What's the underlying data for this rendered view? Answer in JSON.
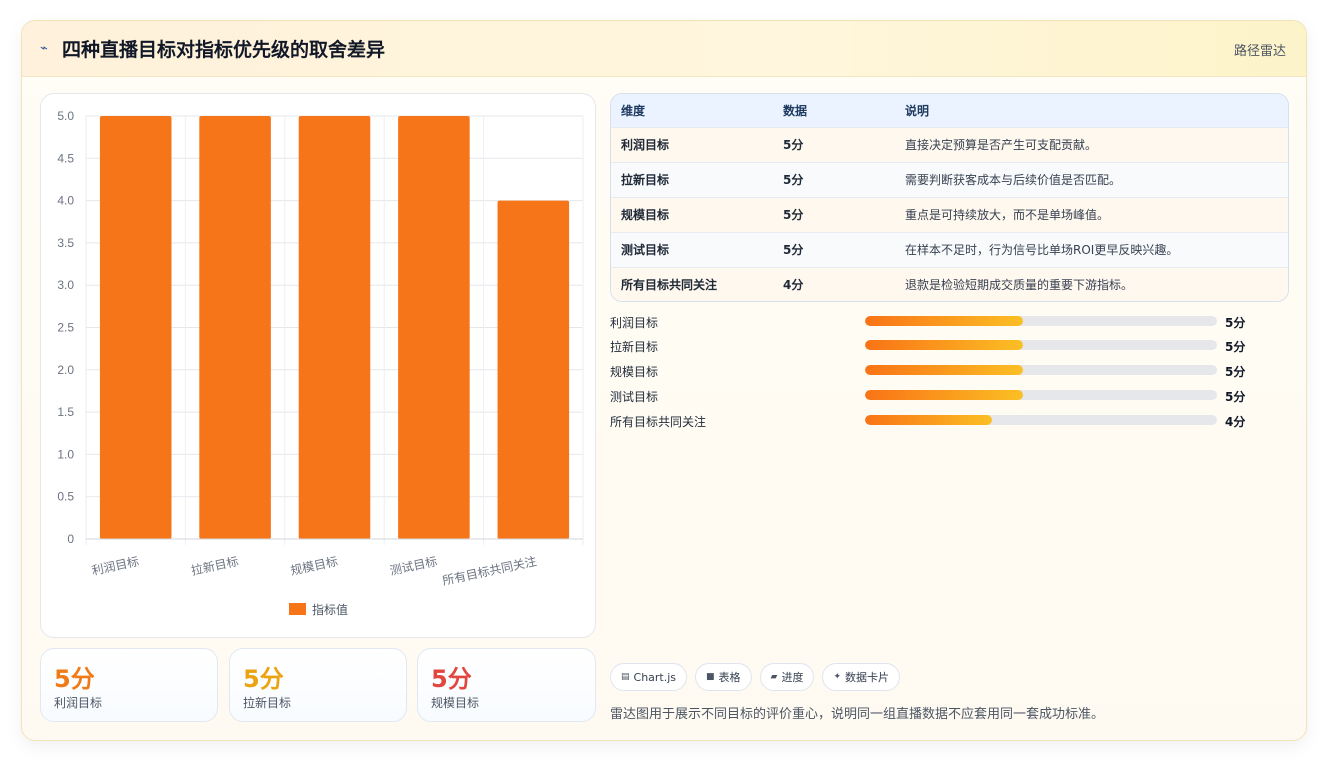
{
  "header": {
    "icon": "sparkle-icon",
    "title": "四种直播目标对指标优先级的取舍差异",
    "tag": "路径雷达"
  },
  "chart_data": {
    "type": "bar",
    "categories": [
      "利润目标",
      "拉新目标",
      "规模目标",
      "测试目标",
      "所有目标共同关注"
    ],
    "series": [
      {
        "name": "指标值",
        "values": [
          5,
          5,
          5,
          5,
          4
        ],
        "color": "#f77519"
      }
    ],
    "ylim": [
      0,
      5
    ],
    "yticks": [
      "0",
      "0.5",
      "1.0",
      "1.5",
      "2.0",
      "2.5",
      "3.0",
      "3.5",
      "4.0",
      "4.5",
      "5.0"
    ],
    "grid": true,
    "legend": "bottom"
  },
  "stats": [
    {
      "value": "5分",
      "label": "利润目标",
      "color": "#f07b16"
    },
    {
      "value": "5分",
      "label": "拉新目标",
      "color": "#eba312"
    },
    {
      "value": "5分",
      "label": "规模目标",
      "color": "#e2473f"
    }
  ],
  "table": {
    "headers": [
      "维度",
      "数据",
      "说明"
    ],
    "rows": [
      [
        "利润目标",
        "5分",
        "直接决定预算是否产生可支配贡献。"
      ],
      [
        "拉新目标",
        "5分",
        "需要判断获客成本与后续价值是否匹配。"
      ],
      [
        "规模目标",
        "5分",
        "重点是可持续放大，而不是单场峰值。"
      ],
      [
        "测试目标",
        "5分",
        "在样本不足时，行为信号比单场ROI更早反映兴趣。"
      ],
      [
        "所有目标共同关注",
        "4分",
        "退款是检验短期成交质量的重要下游指标。"
      ]
    ]
  },
  "progress": [
    {
      "label": "利润目标",
      "value": "5分",
      "fraction": 0.45
    },
    {
      "label": "拉新目标",
      "value": "5分",
      "fraction": 0.45
    },
    {
      "label": "规模目标",
      "value": "5分",
      "fraction": 0.45
    },
    {
      "label": "测试目标",
      "value": "5分",
      "fraction": 0.45
    },
    {
      "label": "所有目标共同关注",
      "value": "4分",
      "fraction": 0.36
    }
  ],
  "chips": [
    {
      "icon": "chart-icon",
      "label": "Chart.js"
    },
    {
      "icon": "table-icon",
      "label": "表格"
    },
    {
      "icon": "progress-icon",
      "label": "进度"
    },
    {
      "icon": "sparkle-icon",
      "label": "数据卡片"
    }
  ],
  "footnote": "雷达图用于展示不同目标的评价重心，说明同一组直播数据不应套用同一套成功标准。"
}
